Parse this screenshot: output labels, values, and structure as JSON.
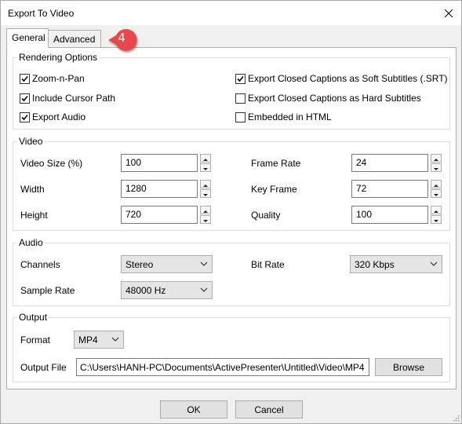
{
  "window": {
    "title": "Export To Video"
  },
  "tabs": [
    {
      "label": "General",
      "active": true
    },
    {
      "label": "Advanced",
      "active": false
    }
  ],
  "badge": {
    "text": "4",
    "color": "#e8474b"
  },
  "rendering": {
    "title": "Rendering Options",
    "left": [
      {
        "label": "Zoom-n-Pan",
        "checked": true
      },
      {
        "label": "Include Cursor Path",
        "checked": true
      },
      {
        "label": "Export Audio",
        "checked": true
      }
    ],
    "right": [
      {
        "label": "Export Closed Captions as Soft Subtitles (.SRT)",
        "checked": true
      },
      {
        "label": "Export Closed Captions as Hard Subtitles",
        "checked": false
      },
      {
        "label": "Embedded in HTML",
        "checked": false
      }
    ]
  },
  "video": {
    "title": "Video",
    "video_size": {
      "label": "Video Size (%)",
      "value": "100"
    },
    "width": {
      "label": "Width",
      "value": "1280"
    },
    "height": {
      "label": "Height",
      "value": "720"
    },
    "frame_rate": {
      "label": "Frame Rate",
      "value": "24"
    },
    "key_frame": {
      "label": "Key Frame",
      "value": "72"
    },
    "quality": {
      "label": "Quality",
      "value": "100"
    }
  },
  "audio": {
    "title": "Audio",
    "channels": {
      "label": "Channels",
      "value": "Stereo"
    },
    "sample_rate": {
      "label": "Sample Rate",
      "value": "48000 Hz"
    },
    "bit_rate": {
      "label": "Bit Rate",
      "value": "320 Kbps"
    }
  },
  "output": {
    "title": "Output",
    "format": {
      "label": "Format",
      "value": "MP4"
    },
    "file": {
      "label": "Output File",
      "value": "C:\\Users\\HANH-PC\\Documents\\ActivePresenter\\Untitled\\Video\\MP4"
    },
    "browse_label": "Browse"
  },
  "footer": {
    "ok_label": "OK",
    "cancel_label": "Cancel"
  }
}
